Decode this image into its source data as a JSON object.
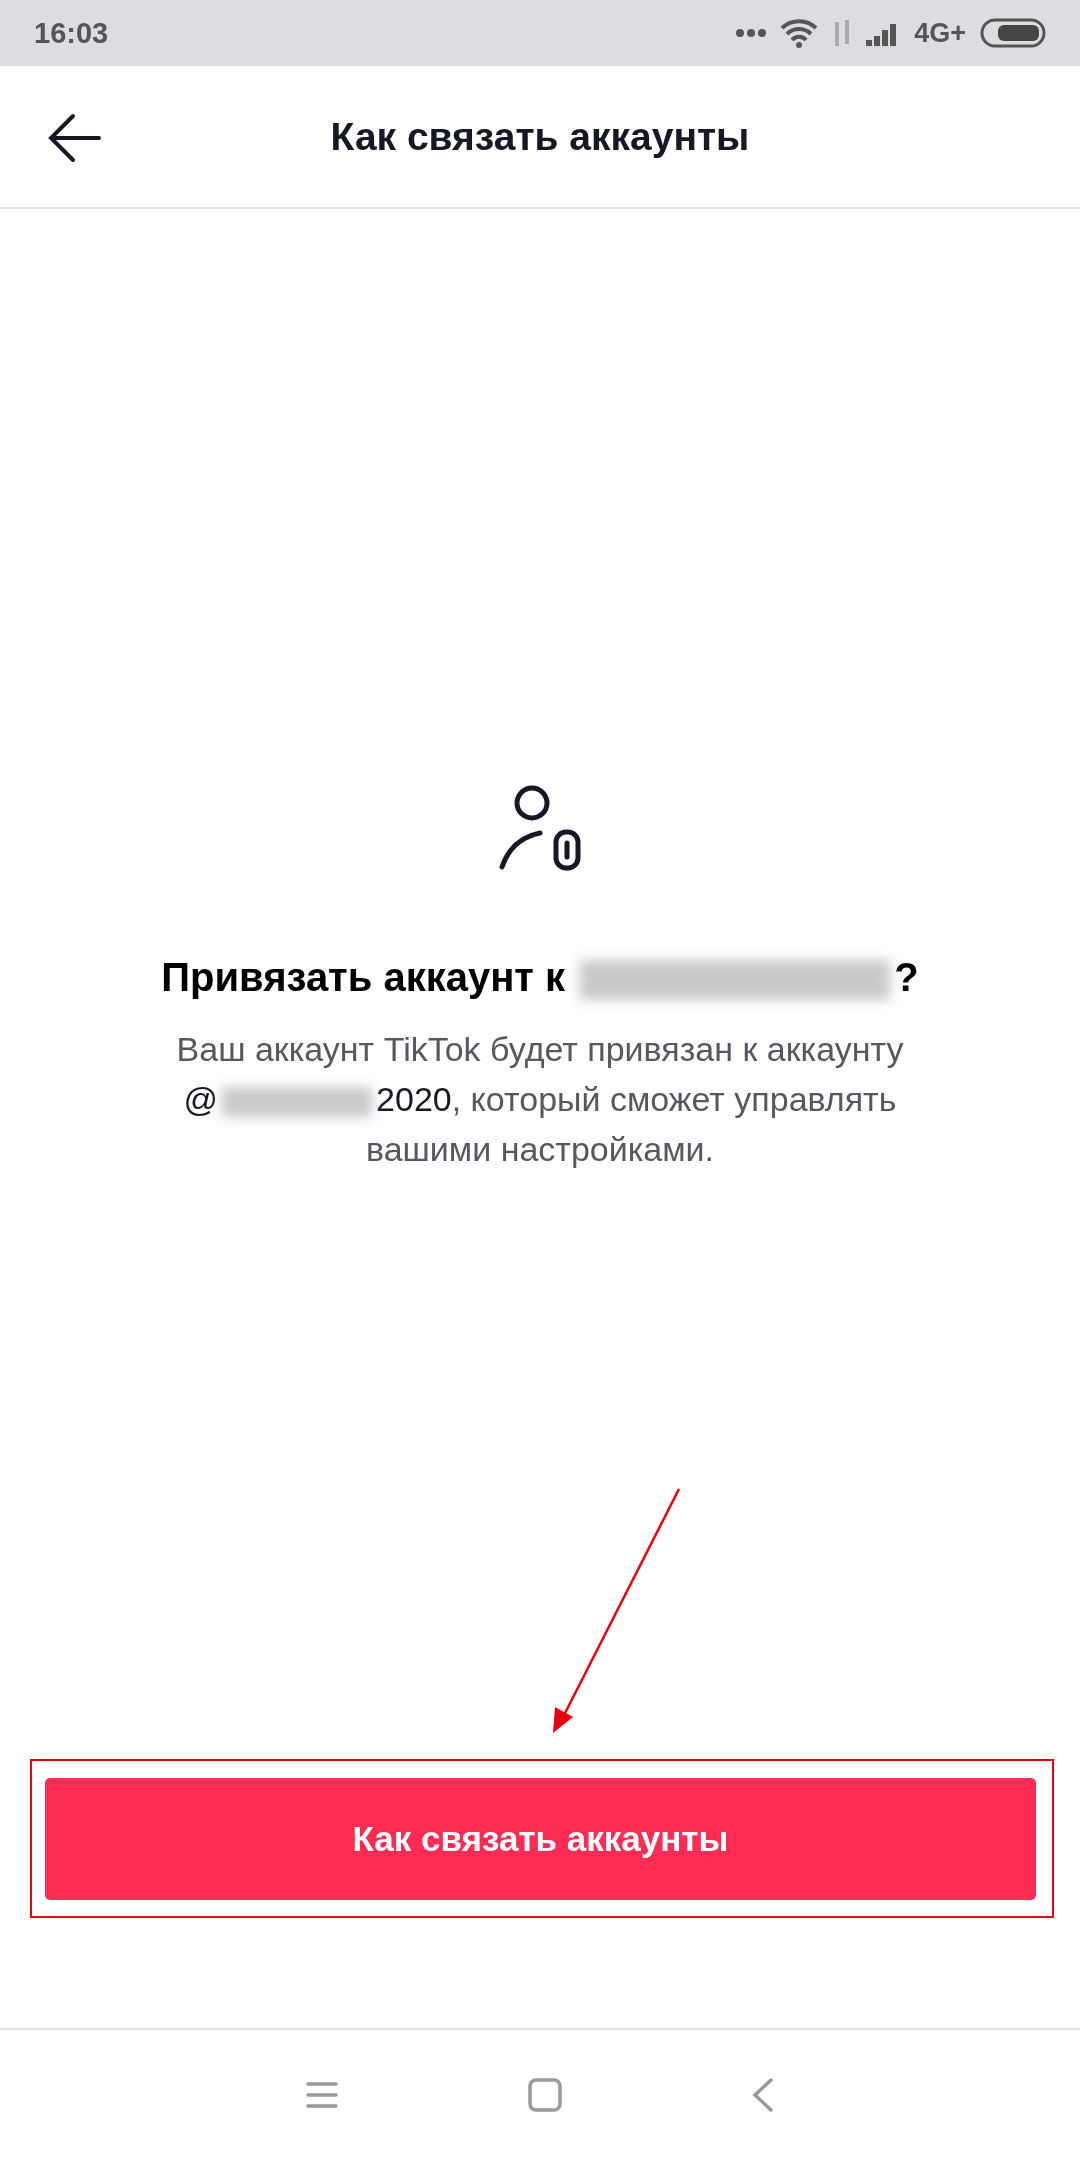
{
  "status_bar": {
    "time": "16:03",
    "network": "4G+"
  },
  "header": {
    "title": "Как связать аккаунты"
  },
  "prompt": {
    "heading_before": "Привязать аккаунт к",
    "heading_after": "?",
    "redacted": true,
    "body_before": "Ваш аккаунт TikTok будет привязан к аккаунту",
    "handle_prefix": "@",
    "body_after": "**2020**, который сможет управлять вашими настройками."
  },
  "button": {
    "label": "Как связать аккаунты",
    "highlighted": true
  }
}
